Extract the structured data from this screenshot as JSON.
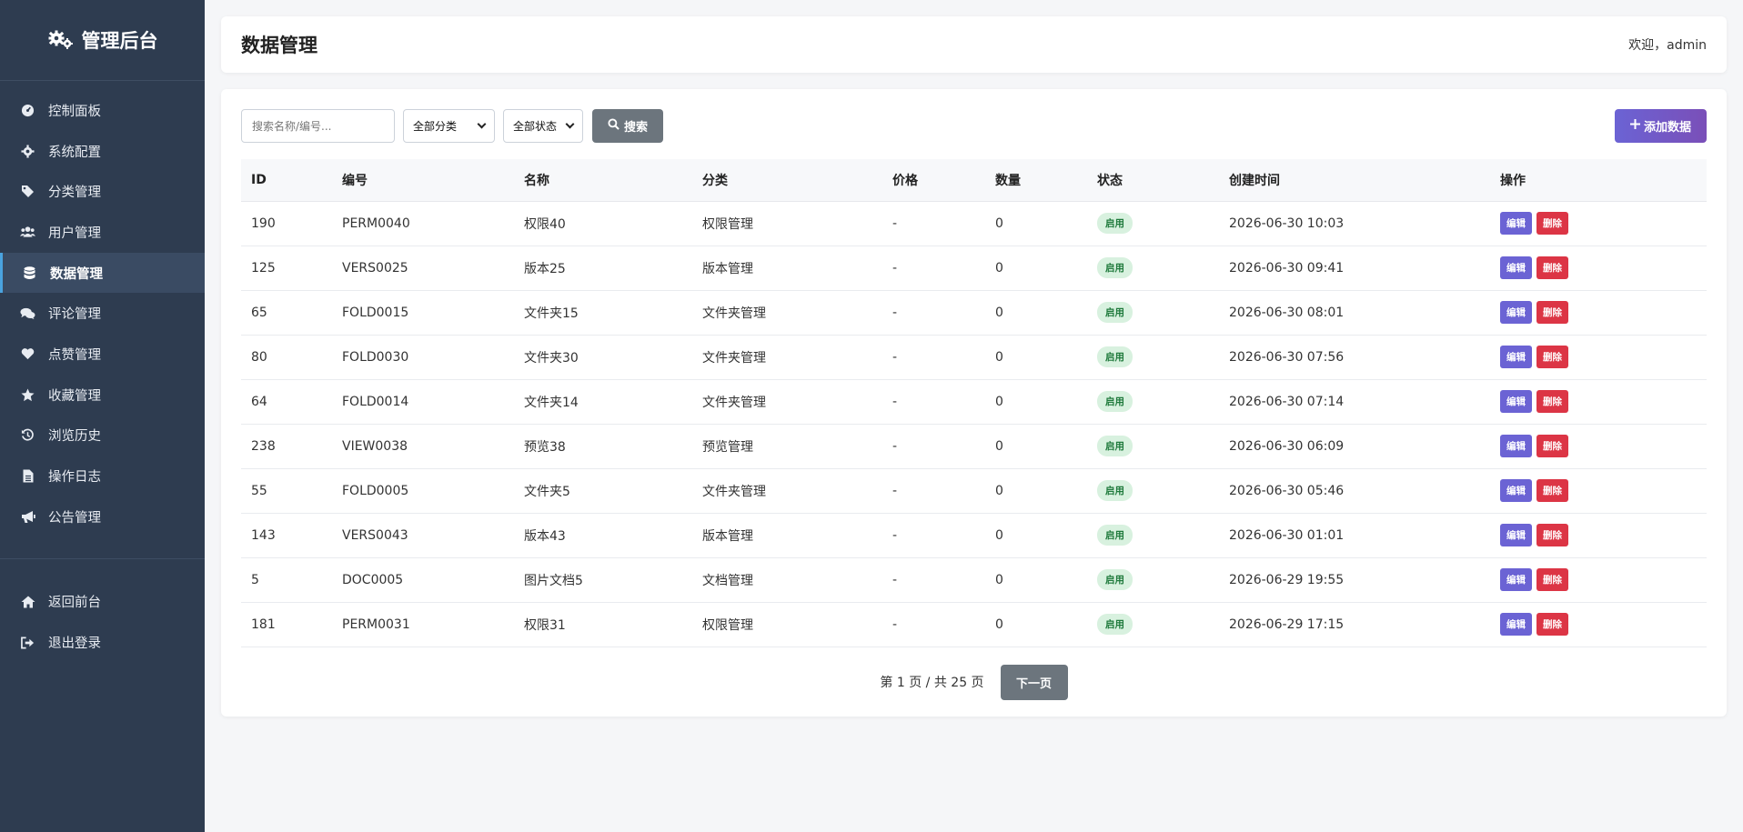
{
  "sidebar": {
    "brand": "管理后台",
    "items": [
      {
        "label": "控制面板",
        "icon": "dashboard-icon"
      },
      {
        "label": "系统配置",
        "icon": "gear-icon"
      },
      {
        "label": "分类管理",
        "icon": "tags-icon"
      },
      {
        "label": "用户管理",
        "icon": "users-icon"
      },
      {
        "label": "数据管理",
        "icon": "database-icon",
        "active": true
      },
      {
        "label": "评论管理",
        "icon": "comments-icon"
      },
      {
        "label": "点赞管理",
        "icon": "heart-icon"
      },
      {
        "label": "收藏管理",
        "icon": "star-icon"
      },
      {
        "label": "浏览历史",
        "icon": "history-icon"
      },
      {
        "label": "操作日志",
        "icon": "file-icon"
      },
      {
        "label": "公告管理",
        "icon": "bullhorn-icon"
      }
    ],
    "bottom_items": [
      {
        "label": "返回前台",
        "icon": "home-icon"
      },
      {
        "label": "退出登录",
        "icon": "sign-out-icon"
      }
    ]
  },
  "header": {
    "title": "数据管理",
    "welcome": "欢迎，admin"
  },
  "toolbar": {
    "search_placeholder": "搜索名称/编号...",
    "category_select": "全部分类",
    "status_select": "全部状态",
    "search_label": "搜索",
    "add_label": "添加数据"
  },
  "table": {
    "columns": [
      "ID",
      "编号",
      "名称",
      "分类",
      "价格",
      "数量",
      "状态",
      "创建时间",
      "操作"
    ],
    "rows": [
      {
        "id": "190",
        "code": "PERM0040",
        "name": "权限40",
        "category": "权限管理",
        "price": "-",
        "qty": "0",
        "status": "启用",
        "created": "2026-06-30 10:03"
      },
      {
        "id": "125",
        "code": "VERS0025",
        "name": "版本25",
        "category": "版本管理",
        "price": "-",
        "qty": "0",
        "status": "启用",
        "created": "2026-06-30 09:41"
      },
      {
        "id": "65",
        "code": "FOLD0015",
        "name": "文件夹15",
        "category": "文件夹管理",
        "price": "-",
        "qty": "0",
        "status": "启用",
        "created": "2026-06-30 08:01"
      },
      {
        "id": "80",
        "code": "FOLD0030",
        "name": "文件夹30",
        "category": "文件夹管理",
        "price": "-",
        "qty": "0",
        "status": "启用",
        "created": "2026-06-30 07:56"
      },
      {
        "id": "64",
        "code": "FOLD0014",
        "name": "文件夹14",
        "category": "文件夹管理",
        "price": "-",
        "qty": "0",
        "status": "启用",
        "created": "2026-06-30 07:14"
      },
      {
        "id": "238",
        "code": "VIEW0038",
        "name": "预览38",
        "category": "预览管理",
        "price": "-",
        "qty": "0",
        "status": "启用",
        "created": "2026-06-30 06:09"
      },
      {
        "id": "55",
        "code": "FOLD0005",
        "name": "文件夹5",
        "category": "文件夹管理",
        "price": "-",
        "qty": "0",
        "status": "启用",
        "created": "2026-06-30 05:46"
      },
      {
        "id": "143",
        "code": "VERS0043",
        "name": "版本43",
        "category": "版本管理",
        "price": "-",
        "qty": "0",
        "status": "启用",
        "created": "2026-06-30 01:01"
      },
      {
        "id": "5",
        "code": "DOC0005",
        "name": "图片文档5",
        "category": "文档管理",
        "price": "-",
        "qty": "0",
        "status": "启用",
        "created": "2026-06-29 19:55"
      },
      {
        "id": "181",
        "code": "PERM0031",
        "name": "权限31",
        "category": "权限管理",
        "price": "-",
        "qty": "0",
        "status": "启用",
        "created": "2026-06-29 17:15"
      }
    ],
    "edit_label": "编辑",
    "delete_label": "删除"
  },
  "pagination": {
    "info": "第 1 页 / 共 25 页",
    "next_label": "下一页"
  },
  "colors": {
    "sidebar_bg": "#2e3c50",
    "accent": "#6b63d4",
    "danger": "#dc3545",
    "badge_bg": "#d8f1df",
    "badge_text": "#1f7a3c"
  }
}
